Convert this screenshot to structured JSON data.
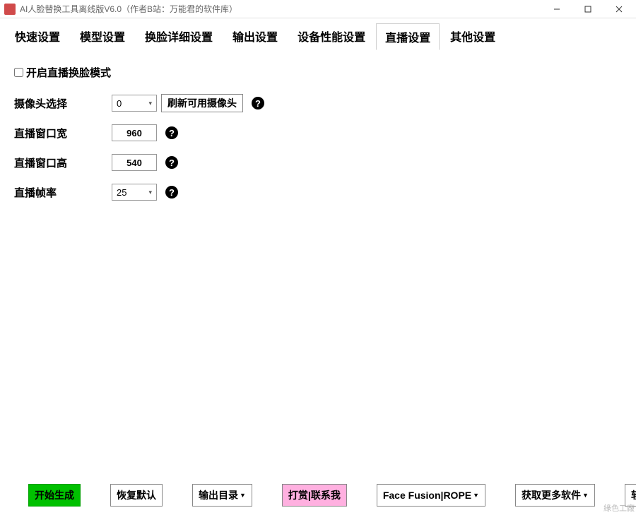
{
  "window": {
    "title": "AI人脸替换工具离线版V6.0（作者B站：万能君的软件库）"
  },
  "tabs": {
    "items": [
      {
        "label": "快速设置"
      },
      {
        "label": "模型设置"
      },
      {
        "label": "换脸详细设置"
      },
      {
        "label": "输出设置"
      },
      {
        "label": "设备性能设置"
      },
      {
        "label": "直播设置"
      },
      {
        "label": "其他设置"
      }
    ],
    "active_index": 5
  },
  "live_settings": {
    "enable_label": "开启直播换脸模式",
    "enable_checked": false,
    "camera_label": "摄像头选择",
    "camera_value": "0",
    "refresh_btn": "刷新可用摄像头",
    "width_label": "直播窗口宽",
    "width_value": "960",
    "height_label": "直播窗口高",
    "height_value": "540",
    "fps_label": "直播帧率",
    "fps_value": "25"
  },
  "footer": {
    "start": "开始生成",
    "restore": "恢复默认",
    "output_dir": "输出目录",
    "donate": "打赏|联系我",
    "fusion": "Face Fusion|ROPE",
    "more_software": "获取更多软件",
    "update": "软件更新"
  },
  "watermark": "綠色工廠"
}
